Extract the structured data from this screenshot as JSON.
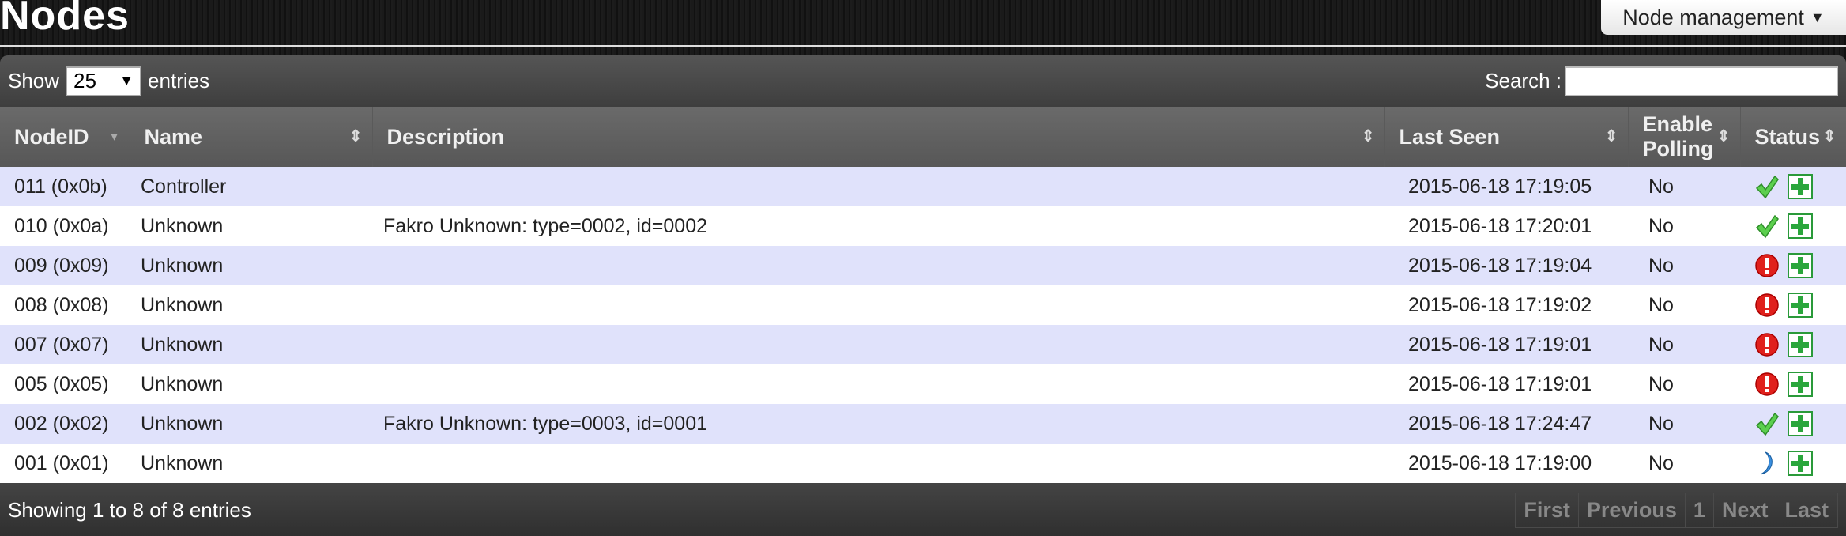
{
  "header": {
    "title": "Nodes",
    "menu_label": "Node management"
  },
  "toolbar": {
    "show_label": "Show",
    "page_size": "25",
    "entries_label": "entries",
    "search_label": "Search :",
    "search_value": ""
  },
  "columns": [
    "NodeID",
    "Name",
    "Description",
    "Last Seen",
    "Enable Polling",
    "Status"
  ],
  "rows": [
    {
      "id": "011 (0x0b)",
      "name": "Controller",
      "desc": "",
      "seen": "2015-06-18 17:19:05",
      "poll": "No",
      "status": "ok"
    },
    {
      "id": "010 (0x0a)",
      "name": "Unknown",
      "desc": "Fakro Unknown: type=0002, id=0002",
      "seen": "2015-06-18 17:20:01",
      "poll": "No",
      "status": "ok"
    },
    {
      "id": "009 (0x09)",
      "name": "Unknown",
      "desc": "",
      "seen": "2015-06-18 17:19:04",
      "poll": "No",
      "status": "error"
    },
    {
      "id": "008 (0x08)",
      "name": "Unknown",
      "desc": "",
      "seen": "2015-06-18 17:19:02",
      "poll": "No",
      "status": "error"
    },
    {
      "id": "007 (0x07)",
      "name": "Unknown",
      "desc": "",
      "seen": "2015-06-18 17:19:01",
      "poll": "No",
      "status": "error"
    },
    {
      "id": "005 (0x05)",
      "name": "Unknown",
      "desc": "",
      "seen": "2015-06-18 17:19:01",
      "poll": "No",
      "status": "error"
    },
    {
      "id": "002 (0x02)",
      "name": "Unknown",
      "desc": "Fakro Unknown: type=0003, id=0001",
      "seen": "2015-06-18 17:24:47",
      "poll": "No",
      "status": "ok"
    },
    {
      "id": "001 (0x01)",
      "name": "Unknown",
      "desc": "",
      "seen": "2015-06-18 17:19:00",
      "poll": "No",
      "status": "sleeping"
    }
  ],
  "status_icons": {
    "ok": "checkmark-icon",
    "error": "error-icon",
    "sleeping": "moon-icon"
  },
  "footer": {
    "info": "Showing 1 to 8 of 8 entries",
    "pager": [
      "First",
      "Previous",
      "1",
      "Next",
      "Last"
    ]
  }
}
